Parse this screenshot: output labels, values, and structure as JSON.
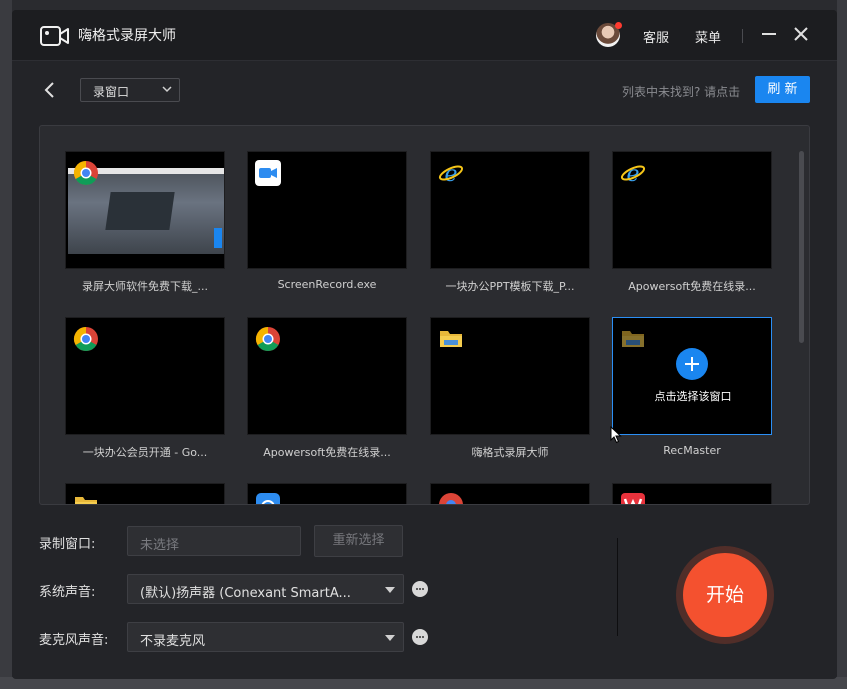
{
  "app": {
    "title": "嗨格式录屏大师",
    "customer_service": "客服",
    "menu": "菜单"
  },
  "toolbar": {
    "mode_value": "录窗口",
    "hint": "列表中未找到? 请点击",
    "refresh_label": "刷 新"
  },
  "windows": [
    {
      "label": "录屏大师软件免费下载_...",
      "icon": "chrome-icon"
    },
    {
      "label": "ScreenRecord.exe",
      "icon": "video-camera-app-icon"
    },
    {
      "label": "一块办公PPT模板下载_P...",
      "icon": "ie-icon"
    },
    {
      "label": "Apowersoft免费在线录...",
      "icon": "ie-icon"
    },
    {
      "label": "一块办公会员开通 - Go...",
      "icon": "chrome-icon"
    },
    {
      "label": "Apowersoft免费在线录...",
      "icon": "chrome-icon"
    },
    {
      "label": "嗨格式录屏大师",
      "icon": "folder-icon"
    },
    {
      "label": "RecMaster",
      "icon": "folder-icon",
      "selected": true,
      "overlay_text": "点击选择该窗口"
    }
  ],
  "partial_row_icons": [
    "folder-icon",
    "app-icon",
    "chrome-icon",
    "wps-icon"
  ],
  "settings": {
    "record_window_label": "录制窗口:",
    "record_window_placeholder": "未选择",
    "reselect_label": "重新选择",
    "system_audio_label": "系统声音:",
    "system_audio_value": "(默认)扬声器 (Conexant SmartA...",
    "mic_audio_label": "麦克风声音:",
    "mic_audio_value": "不录麦克风"
  },
  "start_label": "开始",
  "colors": {
    "accent": "#1a86f0",
    "start": "#f4512f",
    "background": "#232428"
  }
}
